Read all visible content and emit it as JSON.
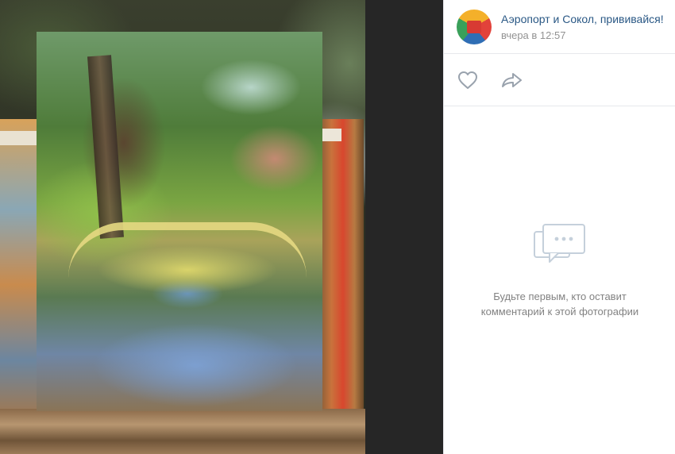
{
  "post": {
    "group_name": "Аэропорт и Сокол, прививайся!",
    "date": "вчера в 12:57",
    "avatar_icon": "group-logo-sokol"
  },
  "actions": {
    "like_icon": "heart-outline-icon",
    "share_icon": "share-arrow-icon"
  },
  "comments": {
    "empty_icon": "chat-bubbles-icon",
    "empty_line1": "Будьте первым, кто оставит",
    "empty_line2": "комментарий к этой фотографии"
  },
  "colors": {
    "link": "#2a5885",
    "meta": "#939393",
    "icon": "#99a2ad",
    "empty_text": "#828282"
  }
}
